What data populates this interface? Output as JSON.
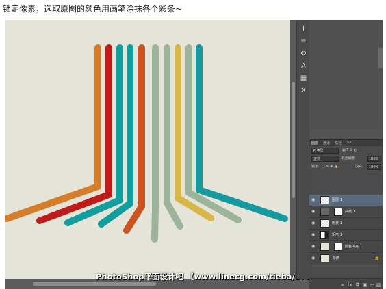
{
  "caption": "锁定像素，选取原图的颜色用画笔涂抹各个彩条~",
  "watermark": "PhotoShop平面设计吧 【www.linecg.com/tieba/1783】",
  "stripe_colors": [
    "#d67d2c",
    "#bf1c1a",
    "#119e9e",
    "#119e9e",
    "#cc5320",
    "#9cb49a",
    "#9cb49a",
    "#d9b648",
    "#9cb49a",
    "#169aa0"
  ],
  "tools": [
    "type-tool-icon",
    "paragraph-icon",
    "settings-icon",
    "text-icon",
    "ruler-icon",
    "transform-icon"
  ],
  "panel": {
    "tabs": [
      "图层",
      "通道",
      "路径",
      "3D"
    ],
    "filter": "P 类型",
    "blend_mode": "正常",
    "opacity_label": "不透明度:",
    "opacity": "100%",
    "lock_label": "锁定:",
    "fill_label": "填充:",
    "fill": "100%",
    "layers": [
      {
        "name": "图层 1"
      },
      {
        "name": "曲线 1"
      },
      {
        "name": "形状 1"
      },
      {
        "name": "矩形 1"
      },
      {
        "name": "颜色填充 1"
      },
      {
        "name": "背景"
      }
    ]
  }
}
